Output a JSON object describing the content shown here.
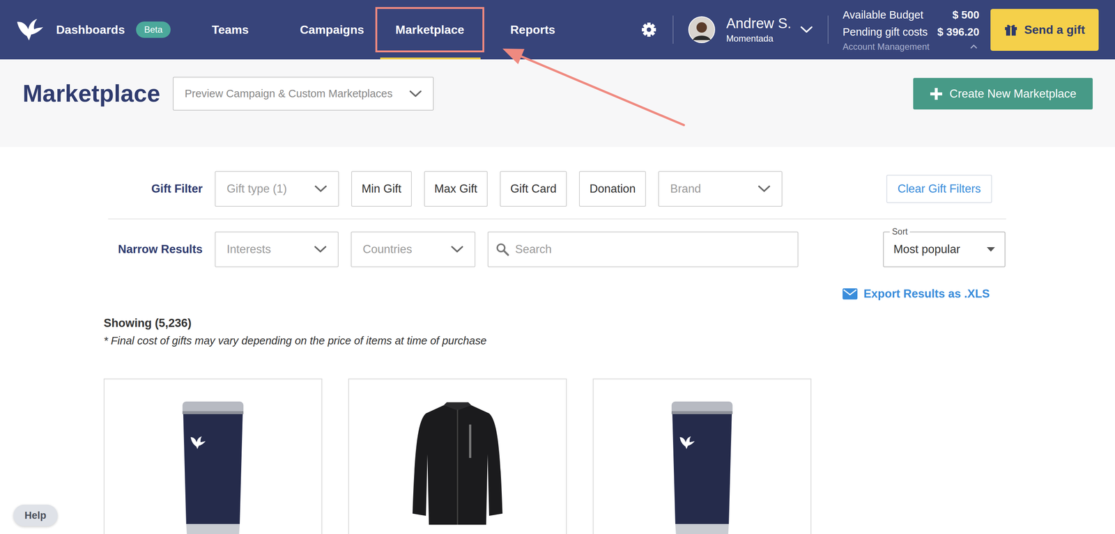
{
  "nav": {
    "items": [
      {
        "label": "Dashboards",
        "badge": "Beta",
        "selected": false,
        "highlighted": false
      },
      {
        "label": "Teams",
        "selected": false,
        "highlighted": false
      },
      {
        "label": "Campaigns",
        "selected": false,
        "highlighted": false
      },
      {
        "label": "Marketplace",
        "selected": true,
        "highlighted": true
      },
      {
        "label": "Reports",
        "selected": false,
        "highlighted": false
      }
    ]
  },
  "user": {
    "name": "Andrew S.",
    "company": "Momentada"
  },
  "budget": {
    "rows": [
      {
        "label": "Available Budget",
        "value": "$ 500"
      },
      {
        "label": "Pending gift costs",
        "value": "$ 396.20"
      }
    ],
    "link": "Account Management",
    "expanded": true
  },
  "send_button": "Send a gift",
  "page": {
    "title": "Marketplace",
    "marketplace_select": "Preview Campaign & Custom Marketplaces",
    "create_button": "Create New Marketplace"
  },
  "gift_filter": {
    "label": "Gift Filter",
    "controls": [
      {
        "label": "Gift type (1)",
        "kind": "dropdown"
      },
      {
        "label": "Min Gift",
        "kind": "button"
      },
      {
        "label": "Max Gift",
        "kind": "button"
      },
      {
        "label": "Gift Card",
        "kind": "button"
      },
      {
        "label": "Donation",
        "kind": "button"
      },
      {
        "label": "Brand",
        "kind": "dropdown"
      }
    ],
    "clear": "Clear Gift Filters"
  },
  "narrow": {
    "label": "Narrow Results",
    "controls": [
      {
        "label": "Interests",
        "kind": "dropdown"
      },
      {
        "label": "Countries",
        "kind": "dropdown"
      },
      {
        "label": "Search",
        "kind": "search"
      }
    ],
    "sort": {
      "label": "Sort",
      "value": "Most popular"
    }
  },
  "export": "Export Results as .XLS",
  "results": {
    "count": "Showing (5,236)",
    "note": "* Final cost of gifts may vary depending on the price of items at time of purchase"
  },
  "products": [
    {
      "kind": "tumbler"
    },
    {
      "kind": "jacket"
    },
    {
      "kind": "tumbler"
    }
  ],
  "help": "Help"
}
